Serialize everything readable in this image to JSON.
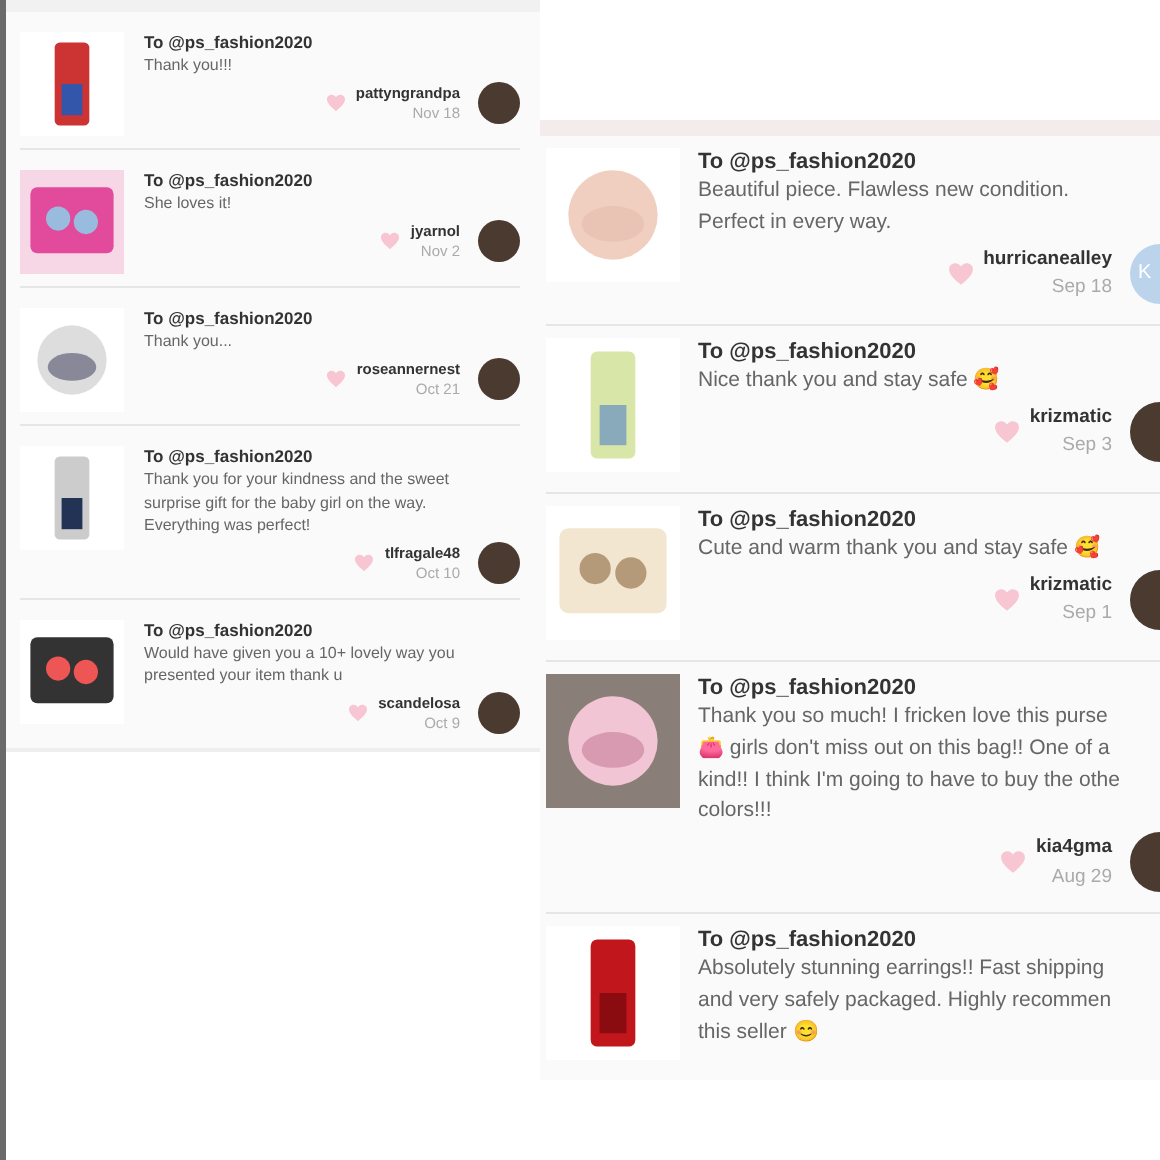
{
  "panels": [
    {
      "reviews": [
        {
          "to": "To @ps_fashion2020",
          "text": "Thank you!!!",
          "user": "pattyngrandpa",
          "date": "Nov 18"
        },
        {
          "to": "To @ps_fashion2020",
          "text": "She loves it!",
          "user": "jyarnol",
          "date": "Nov 2"
        },
        {
          "to": "To @ps_fashion2020",
          "text": "Thank you...",
          "user": "roseannernest",
          "date": "Oct 21"
        },
        {
          "to": "To @ps_fashion2020",
          "text": "Thank you for your kindness and the sweet\nsurprise gift for the baby girl on the way.\nEverything was perfect!",
          "user": "tlfragale48",
          "date": "Oct 10"
        },
        {
          "to": "To @ps_fashion2020",
          "text": "Would have given you a 10+ lovely way you\npresented your item thank u",
          "user": "scandelosa",
          "date": "Oct 9"
        }
      ]
    },
    {
      "reviews": [
        {
          "to": "To @ps_fashion2020",
          "text": "Beautiful piece. Flawless new condition.\nPerfect in every way.",
          "user": "hurricanealley",
          "date": "Sep 18",
          "avatar": {
            "kind": "initials",
            "initials": "K"
          }
        },
        {
          "to": "To @ps_fashion2020",
          "text": "Nice thank you and stay safe 🥰",
          "user": "krizmatic",
          "date": "Sep 3"
        },
        {
          "to": "To @ps_fashion2020",
          "text": "Cute and warm thank you and stay safe 🥰",
          "user": "krizmatic",
          "date": "Sep 1"
        },
        {
          "to": "To @ps_fashion2020",
          "text": "Thank you so much! I fricken love this purse\n👛 girls don't miss out on this bag!! One of a\nkind!! I think I'm going to have to buy the othe\ncolors!!!",
          "user": "kia4gma",
          "date": "Aug 29"
        },
        {
          "to": "To @ps_fashion2020",
          "text": "Absolutely stunning earrings!! Fast shipping\nand very safely packaged. Highly recommen\nthis seller 😊"
        }
      ]
    }
  ]
}
